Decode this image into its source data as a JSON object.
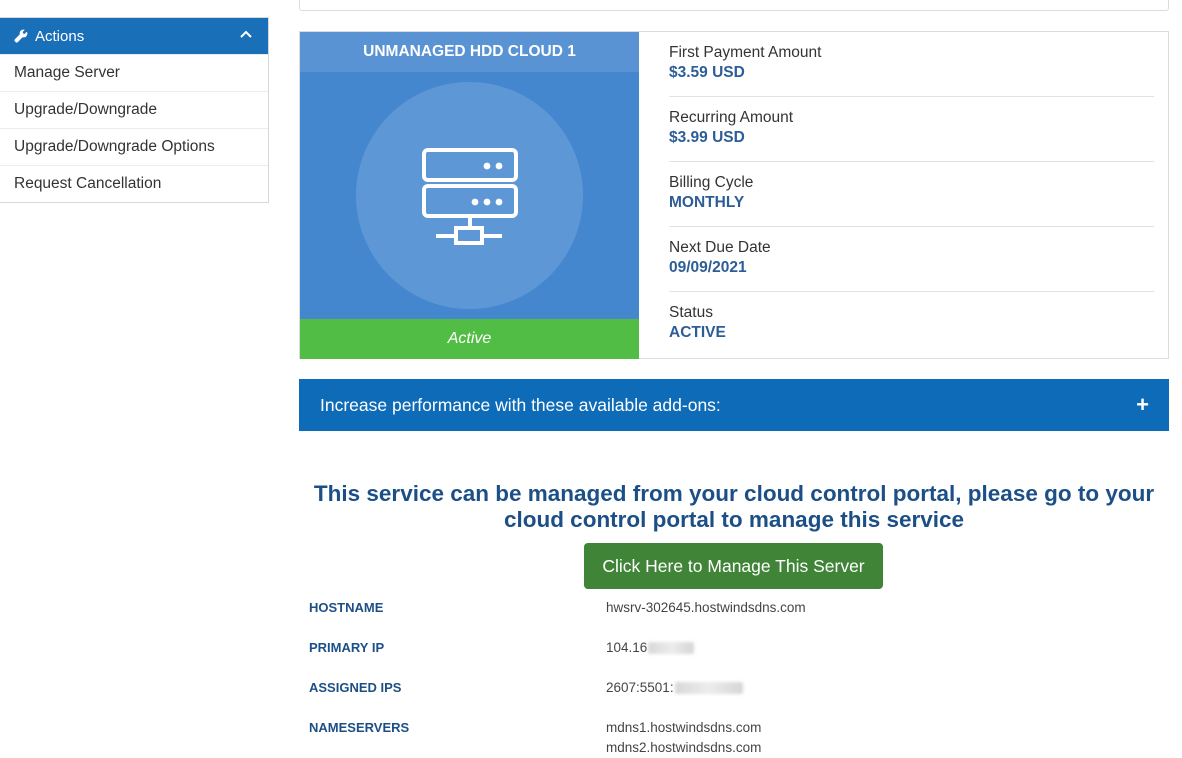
{
  "sidebar": {
    "header": "Actions",
    "items": [
      {
        "label": "Manage Server"
      },
      {
        "label": "Upgrade/Downgrade"
      },
      {
        "label": "Upgrade/Downgrade Options"
      },
      {
        "label": "Request Cancellation"
      }
    ]
  },
  "product": {
    "title": "UNMANAGED HDD CLOUD 1",
    "status": "Active",
    "info": [
      {
        "label": "First Payment Amount",
        "value": "$3.59 USD"
      },
      {
        "label": "Recurring Amount",
        "value": "$3.99 USD"
      },
      {
        "label": "Billing Cycle",
        "value": "MONTHLY"
      },
      {
        "label": "Next Due Date",
        "value": "09/09/2021"
      },
      {
        "label": "Status",
        "value": "ACTIVE"
      }
    ]
  },
  "addons": {
    "label": "Increase performance with these available add-ons:",
    "toggle": "+"
  },
  "portal": {
    "notice": "This service can be managed from your cloud control portal, please go to your cloud control portal to manage this service",
    "button_label": "Click Here to Manage This Server"
  },
  "details": {
    "hostname_label": "HOSTNAME",
    "hostname": "hwsrv-302645.hostwindsdns.com",
    "primary_ip_label": "PRIMARY IP",
    "primary_ip": "104.16",
    "assigned_ips_label": "ASSIGNED IPS",
    "assigned_ips": "2607:5501:",
    "nameservers_label": "NAMESERVERS",
    "nameserver_1": "mdns1.hostwindsdns.com",
    "nameserver_2": "mdns2.hostwindsdns.com"
  },
  "colors": {
    "primary_blue": "#1a6fb9",
    "product_blue": "#4487cf",
    "status_green": "#52bd45",
    "button_green": "#3f8437",
    "heading_navy": "#1d4f87"
  }
}
